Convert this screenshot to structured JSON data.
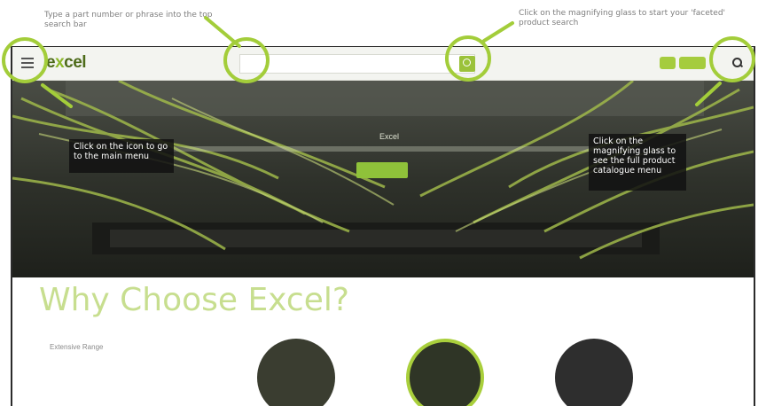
{
  "annotations": {
    "search_bar": "Type a part number or phrase into the top search bar",
    "faceted_search": "Click on the magnifying glass to start your 'faceted' product search",
    "main_menu": "Click on the icon to go to the main menu",
    "catalogue_menu": "Click on the magnifying glass to see the full product catalogue menu"
  },
  "header": {
    "logo_prefix": "e",
    "logo_x": "x",
    "logo_suffix": "cel",
    "menu_icon": "hamburger-icon",
    "search_icon": "search-icon"
  },
  "hero": {
    "title": "Excel"
  },
  "main": {
    "heading": "Why Choose Excel?",
    "feature_item": "Extensive Range"
  },
  "colors": {
    "accent": "#a3cd3a",
    "brand_dark": "#4d6b1a"
  }
}
